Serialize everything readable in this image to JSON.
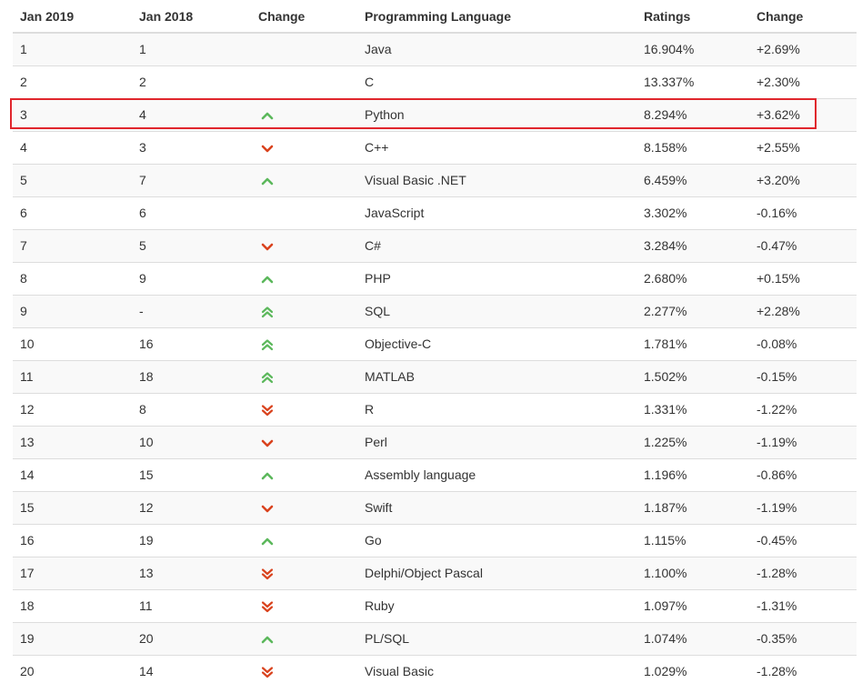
{
  "headers": {
    "col1": "Jan 2019",
    "col2": "Jan 2018",
    "col3": "Change",
    "col4": "Programming Language",
    "col5": "Ratings",
    "col6": "Change"
  },
  "colors": {
    "up": "#5cb85c",
    "down": "#d9431e",
    "highlight_border": "#e0262d"
  },
  "rows": [
    {
      "rank2019": "1",
      "rank2018": "1",
      "trend": "none",
      "language": "Java",
      "rating": "16.904%",
      "change": "+2.69%"
    },
    {
      "rank2019": "2",
      "rank2018": "2",
      "trend": "none",
      "language": "C",
      "rating": "13.337%",
      "change": "+2.30%"
    },
    {
      "rank2019": "3",
      "rank2018": "4",
      "trend": "up",
      "language": "Python",
      "rating": "8.294%",
      "change": "+3.62%"
    },
    {
      "rank2019": "4",
      "rank2018": "3",
      "trend": "down",
      "language": "C++",
      "rating": "8.158%",
      "change": "+2.55%"
    },
    {
      "rank2019": "5",
      "rank2018": "7",
      "trend": "up",
      "language": "Visual Basic .NET",
      "rating": "6.459%",
      "change": "+3.20%"
    },
    {
      "rank2019": "6",
      "rank2018": "6",
      "trend": "none",
      "language": "JavaScript",
      "rating": "3.302%",
      "change": "-0.16%"
    },
    {
      "rank2019": "7",
      "rank2018": "5",
      "trend": "down",
      "language": "C#",
      "rating": "3.284%",
      "change": "-0.47%"
    },
    {
      "rank2019": "8",
      "rank2018": "9",
      "trend": "up",
      "language": "PHP",
      "rating": "2.680%",
      "change": "+0.15%"
    },
    {
      "rank2019": "9",
      "rank2018": "-",
      "trend": "double-up",
      "language": "SQL",
      "rating": "2.277%",
      "change": "+2.28%"
    },
    {
      "rank2019": "10",
      "rank2018": "16",
      "trend": "double-up",
      "language": "Objective-C",
      "rating": "1.781%",
      "change": "-0.08%"
    },
    {
      "rank2019": "11",
      "rank2018": "18",
      "trend": "double-up",
      "language": "MATLAB",
      "rating": "1.502%",
      "change": "-0.15%"
    },
    {
      "rank2019": "12",
      "rank2018": "8",
      "trend": "double-down",
      "language": "R",
      "rating": "1.331%",
      "change": "-1.22%"
    },
    {
      "rank2019": "13",
      "rank2018": "10",
      "trend": "down",
      "language": "Perl",
      "rating": "1.225%",
      "change": "-1.19%"
    },
    {
      "rank2019": "14",
      "rank2018": "15",
      "trend": "up",
      "language": "Assembly language",
      "rating": "1.196%",
      "change": "-0.86%"
    },
    {
      "rank2019": "15",
      "rank2018": "12",
      "trend": "down",
      "language": "Swift",
      "rating": "1.187%",
      "change": "-1.19%"
    },
    {
      "rank2019": "16",
      "rank2018": "19",
      "trend": "up",
      "language": "Go",
      "rating": "1.115%",
      "change": "-0.45%"
    },
    {
      "rank2019": "17",
      "rank2018": "13",
      "trend": "double-down",
      "language": "Delphi/Object Pascal",
      "rating": "1.100%",
      "change": "-1.28%"
    },
    {
      "rank2019": "18",
      "rank2018": "11",
      "trend": "double-down",
      "language": "Ruby",
      "rating": "1.097%",
      "change": "-1.31%"
    },
    {
      "rank2019": "19",
      "rank2018": "20",
      "trend": "up",
      "language": "PL/SQL",
      "rating": "1.074%",
      "change": "-0.35%"
    },
    {
      "rank2019": "20",
      "rank2018": "14",
      "trend": "double-down",
      "language": "Visual Basic",
      "rating": "1.029%",
      "change": "-1.28%"
    }
  ],
  "highlighted_row_language": "Python"
}
